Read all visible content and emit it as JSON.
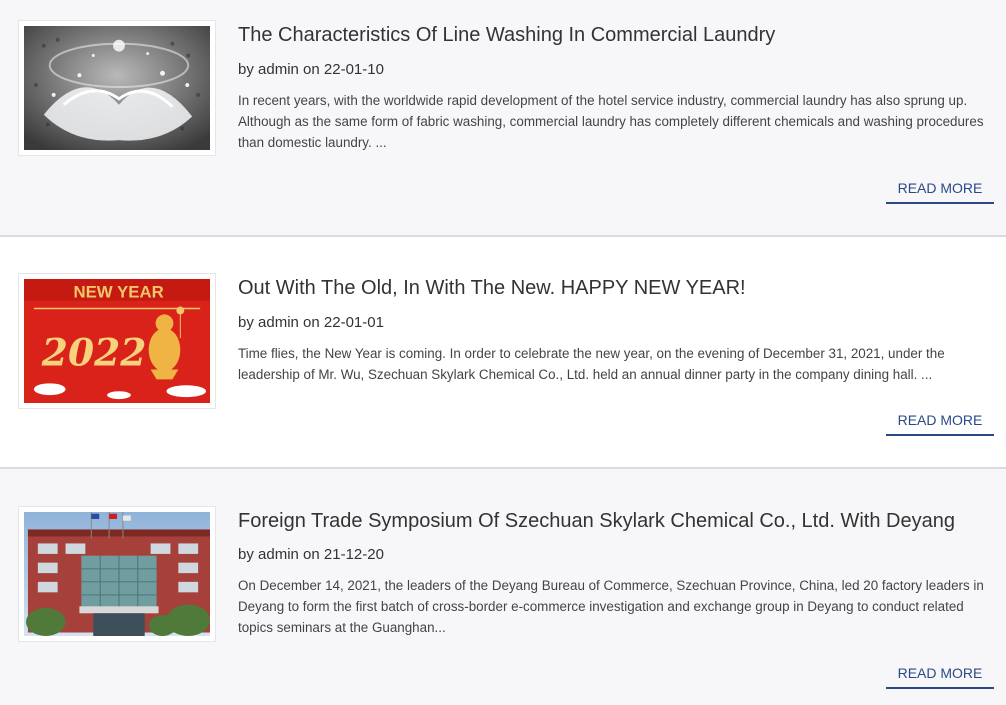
{
  "posts": [
    {
      "title": "The Characteristics Of Line Washing In Commercial Laundry",
      "by_prefix": "by",
      "author": "admin",
      "on_word": "on",
      "date": "22-01-10",
      "excerpt": "In recent years, with the worldwide rapid development of the hotel service industry, commercial laundry has also sprung up. Although as the same form of fabric washing, commercial laundry has completely different chemicals and washing procedures than domestic laundry. ...",
      "read_more": "READ MORE",
      "image_desc": "washing-machine-water-splash"
    },
    {
      "title": "Out With The Old, In With The New. HAPPY NEW YEAR!",
      "by_prefix": "by",
      "author": "admin",
      "on_word": "on",
      "date": "22-01-01",
      "excerpt": "Time flies, the New Year is coming. In order to celebrate the new year, on the evening of December 31, 2021, under the leadership of Mr. Wu, Szechuan Skylark Chemical Co., Ltd. held an annual dinner party in the company dining hall. ...",
      "read_more": "READ MORE",
      "image_desc": "new-year-2022-banner",
      "image_text": {
        "headline": "NEW YEAR",
        "year": "2022"
      }
    },
    {
      "title": "Foreign Trade Symposium Of Szechuan Skylark Chemical Co., Ltd. With Deyang",
      "by_prefix": "by",
      "author": "admin",
      "on_word": "on",
      "date": "21-12-20",
      "excerpt": "On December 14, 2021, the leaders of the Deyang Bureau of Commerce, Szechuan Province, China, led 20 factory leaders in Deyang to form the first batch of cross-border e-commerce investigation and exchange group in Deyang to conduct related topics seminars at the Guanghan...",
      "read_more": "READ MORE",
      "image_desc": "office-building-photo"
    }
  ],
  "colors": {
    "link": "#2a4a86",
    "banner_red": "#d9231a",
    "banner_gold": "#f3c66a"
  }
}
